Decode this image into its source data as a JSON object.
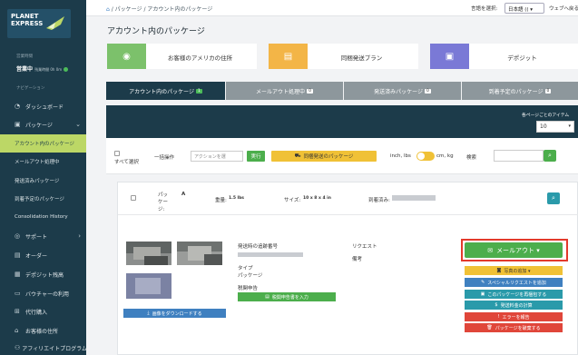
{
  "sidebar": {
    "logo_text": "PLANET EXPRESS",
    "hours_label": "営業時間",
    "status": "営業中",
    "status_detail": "残業時間 0h 0m",
    "nav_label": "ナビゲーション",
    "items": [
      {
        "icon": "dashboard-icon",
        "glyph": "◔",
        "label": "ダッシュボード"
      },
      {
        "icon": "package-icon",
        "glyph": "▣",
        "label": "パッケージ"
      },
      {
        "icon": "support-icon",
        "glyph": "◎",
        "label": "サポート"
      },
      {
        "icon": "order-icon",
        "glyph": "▤",
        "label": "オーダー"
      },
      {
        "icon": "deposit-icon",
        "glyph": "▦",
        "label": "デポジット残高"
      },
      {
        "icon": "voucher-icon",
        "glyph": "▭",
        "label": "バウチャーの利用"
      },
      {
        "icon": "proxy-icon",
        "glyph": "⊞",
        "label": "代行購入"
      },
      {
        "icon": "address-icon",
        "glyph": "⌂",
        "label": "お客様の住所"
      },
      {
        "icon": "affiliate-icon",
        "glyph": "⚇",
        "label": "アフィリエイトプログラム"
      }
    ],
    "sub_items": [
      "アカウント内のパッケージ",
      "メールアウト処理中",
      "発送済みパッケージ",
      "到着予定のパッケージ",
      "Consolidation History"
    ]
  },
  "topbar": {
    "crumb_home": "⌂",
    "crumb": "/ パッケージ / アカウント内のパッケージ",
    "lang_label": "言語を選択:",
    "lang_value": "日本語 (( ▾",
    "right": "ウェブへ戻る"
  },
  "page_title": "アカウント内のパッケージ",
  "cards": [
    {
      "label": "お客様のアメリカの住所",
      "color": "#7cc16b",
      "glyph": "◉"
    },
    {
      "label": "同梱発送プラン",
      "color": "#f3b547",
      "glyph": "▤"
    },
    {
      "label": "デポジット",
      "color": "#7a79d6",
      "glyph": "▣"
    }
  ],
  "tabs": [
    {
      "label": "アカウント内のパッケージ",
      "count": "1"
    },
    {
      "label": "メールアウト処理中",
      "count": "0"
    },
    {
      "label": "発送済みパッケージ",
      "count": "0"
    },
    {
      "label": "到着予定のパッケージ",
      "count": "0"
    }
  ],
  "per_page_label": "各ページごとのアイテム",
  "per_page_value": "10",
  "filter": {
    "select_all": "すべて選択",
    "bulk_label": "一括操作",
    "action_placeholder": "アクションを選",
    "run": "実行",
    "ship_combined": "同梱発送のパッケージ",
    "unit_left": "inch, lbs",
    "unit_right": "cm, kg",
    "search_label": "検索"
  },
  "package": {
    "name_label": "パッケー ジ:",
    "name_value": "A",
    "weight_label": "重量:",
    "weight_value": "1.5 lbs",
    "size_label": "サイズ:",
    "size_value": "10 x 8 x 4 in",
    "arrival_label": "到着済み:",
    "tracking_label": "発送時の追跡番号",
    "type_label": "タイプ",
    "type_value": "パッケージ",
    "declaration_label": "税関申告",
    "declaration_button": "税関申告書を入力",
    "request_label": "リクエスト",
    "notes_label": "備考",
    "download_button": "画像をダウンロードする",
    "mailout_button": "メールアウト ▾",
    "actions": [
      {
        "label": "写真の追加 ▾",
        "color": "#f0c136",
        "text": "#333"
      },
      {
        "label": "スペシャルリクエストを追加",
        "color": "#3f80c0",
        "text": "#fff"
      },
      {
        "label": "このパッケージを再梱包する",
        "color": "#2a9aaa",
        "text": "#fff"
      },
      {
        "label": "発送料金の計算",
        "color": "#2a9aaa",
        "text": "#fff"
      },
      {
        "label": "エラーを報告",
        "color": "#e0463a",
        "text": "#fff"
      },
      {
        "label": "パッケージを破棄する",
        "color": "#e0463a",
        "text": "#fff"
      }
    ]
  }
}
